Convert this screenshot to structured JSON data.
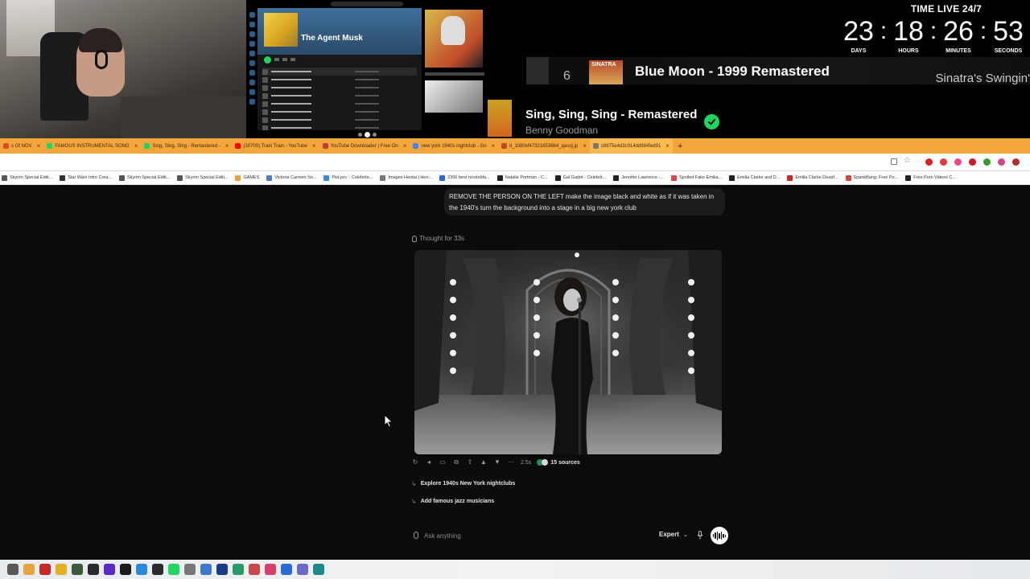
{
  "overlay": {
    "playlist_title": "The Agent Musk",
    "clock": {
      "label": "TIME LIVE 24/7",
      "units": [
        {
          "value": "23",
          "label": "DAYS"
        },
        {
          "value": "18",
          "label": "HOURS"
        },
        {
          "value": "26",
          "label": "MINUTES"
        },
        {
          "value": "53",
          "label": "SECONDS"
        }
      ]
    },
    "queue_track": {
      "number": "6",
      "cover_text": "SINATRA",
      "title": "Blue Moon - 1999 Remastered",
      "album": "Sinatra's Swingin'"
    },
    "now_playing": {
      "title": "Sing, Sing, Sing - Remastered",
      "artist": "Benny Goodman"
    }
  },
  "browser": {
    "tabs": [
      {
        "label": "s Of NOV",
        "color": "#e04a2a"
      },
      {
        "label": "FAMOUS INSTRUMENTAL SONG",
        "color": "#1ed760"
      },
      {
        "label": "Sing, Sing, Sing - Remastered -",
        "color": "#1ed760"
      },
      {
        "label": "(30700) Train Train - YouTube",
        "color": "#ff0000"
      },
      {
        "label": "YouTube Downloader | Free On",
        "color": "#c43a3a"
      },
      {
        "label": "new york 1940s nightclub - Go",
        "color": "#4285f4"
      },
      {
        "label": "ti_1080xf47321653664_qasoj.jp",
        "color": "#b84a2a"
      },
      {
        "label": "c8975e4d3c914dd984fed91",
        "color": "#777777",
        "active": true
      }
    ],
    "bookmarks": [
      {
        "label": "Skyrim Special Editi...",
        "color": "#555555"
      },
      {
        "label": "Star Wars Intro Crea...",
        "color": "#333333"
      },
      {
        "label": "Skyrim Special Editi...",
        "color": "#555555"
      },
      {
        "label": "Skyrim Special Editi...",
        "color": "#555555"
      },
      {
        "label": "GAMES",
        "color": "#e8a33a"
      },
      {
        "label": "Victoria Carmen So...",
        "color": "#4a7ac8"
      },
      {
        "label": "Pixl.pro :: Celebrite...",
        "color": "#3a8ae0"
      },
      {
        "label": "Images Hentai | Hen...",
        "color": "#777777"
      },
      {
        "label": "2366 best n/celebfa...",
        "color": "#2a6ad8"
      },
      {
        "label": "Natalie Portman - C...",
        "color": "#222222"
      },
      {
        "label": "Gal Gadot - Celebrit...",
        "color": "#222222"
      },
      {
        "label": "Jennifer Lawrence -...",
        "color": "#222222"
      },
      {
        "label": "Spoiled Fake Emilia...",
        "color": "#d44a4a"
      },
      {
        "label": "Emilia Clarke and D...",
        "color": "#222222"
      },
      {
        "label": "Emilia Clarke Deepf...",
        "color": "#c8282a"
      },
      {
        "label": "SpankBang: Free Po...",
        "color": "#e0443a"
      },
      {
        "label": "Free Porn Videos C...",
        "color": "#222222"
      }
    ]
  },
  "chat": {
    "user_message": "REMOVE THE PERSON ON THE LEFT make the image black and white as if it was taken in the 1940's turn the background into a stage in a big new york club",
    "thought_label": "Thought for 33s",
    "response_time": "2.5s",
    "sources_label": "15 sources",
    "followups": [
      "Explore 1940s New York nightclubs",
      "Add famous jazz musicians"
    ],
    "composer": {
      "placeholder": "Ask anything",
      "mode": "Expert"
    }
  },
  "taskbar": {
    "apps": [
      "#5a5a5a",
      "#e8a33a",
      "#c8282a",
      "#e0b020",
      "#3a5a3a",
      "#2a2a2a",
      "#5a2ac8",
      "#1a1a1a",
      "#2a8ae0",
      "#2a2a2a",
      "#1ed760",
      "#777777",
      "#3a7ac8",
      "#1a3a8a",
      "#2a9a6a",
      "#c84a4a",
      "#d8406a",
      "#2a6ad8",
      "#6a6ac8",
      "#1a8a8a"
    ]
  }
}
